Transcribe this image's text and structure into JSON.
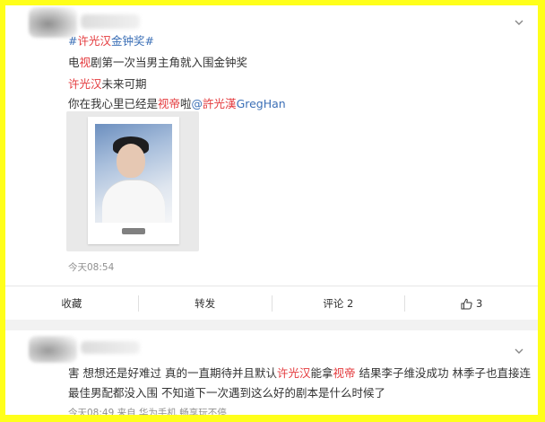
{
  "post1": {
    "hashtag_open": "#",
    "hashtag_name": "许光汉",
    "hashtag_rest": "金钟奖",
    "hashtag_close": "#",
    "line2_a": "电",
    "line2_b": "视",
    "line2_c": "剧第一次当男主角就入围金钟奖",
    "line3_a": "许光汉",
    "line3_b": "未来可期",
    "line4_a": "你在我心里已经是",
    "line4_b": "视帝",
    "line4_c": "啦",
    "line4_mention_at": "@",
    "line4_mention_name": "許光漢",
    "line4_mention_en": "GregHan",
    "timestamp": "今天08:54",
    "actions": {
      "collect": "收藏",
      "repost": "转发",
      "comment": "评论 2",
      "like_count": "3"
    }
  },
  "post2": {
    "text_a": "害 想想还是好难过 真的一直期待并且默认",
    "text_b": "许光汉",
    "text_c": "能拿",
    "text_d": "视帝",
    "text_e": " 结果李子维没成功 林季子也直接连",
    "text_line2": "最佳男配都没入围 不知道下一次遇到这么好的剧本是什么时候了",
    "timestamp": "今天08:49  来自 华为手机 畅享玩不停"
  },
  "icons": {
    "chevron": "chevron-down-icon",
    "like": "thumbs-up-icon"
  },
  "colors": {
    "highlight_red": "#e4393c",
    "link_blue": "#3b6fb6",
    "frame_yellow": "#ffff1a"
  }
}
